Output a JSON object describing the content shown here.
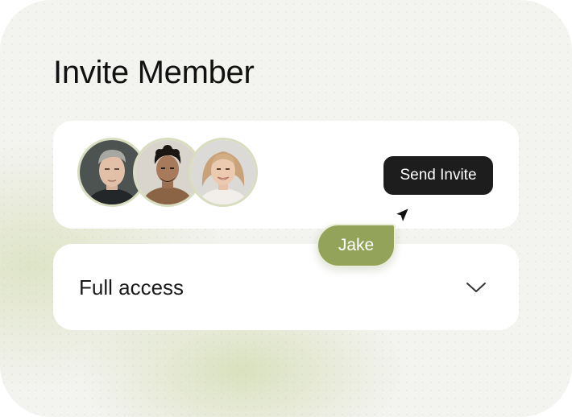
{
  "title": "Invite Member",
  "members": [
    {
      "name": "member-1",
      "avatar_icon": "person-short-gray-hair-icon"
    },
    {
      "name": "member-2",
      "avatar_icon": "person-dark-curly-hair-icon"
    },
    {
      "name": "member-3",
      "avatar_icon": "person-blonde-hair-icon"
    }
  ],
  "send_invite_label": "Send Invite",
  "cursor_label": "Jake",
  "access": {
    "selected": "Full access",
    "chevron_icon": "chevron-down-icon"
  },
  "colors": {
    "background": "#f3f3ef",
    "panel": "#ffffff",
    "button": "#1d1d1d",
    "tag": "#93a45a",
    "avatar_ring": "#d8ddc0"
  }
}
